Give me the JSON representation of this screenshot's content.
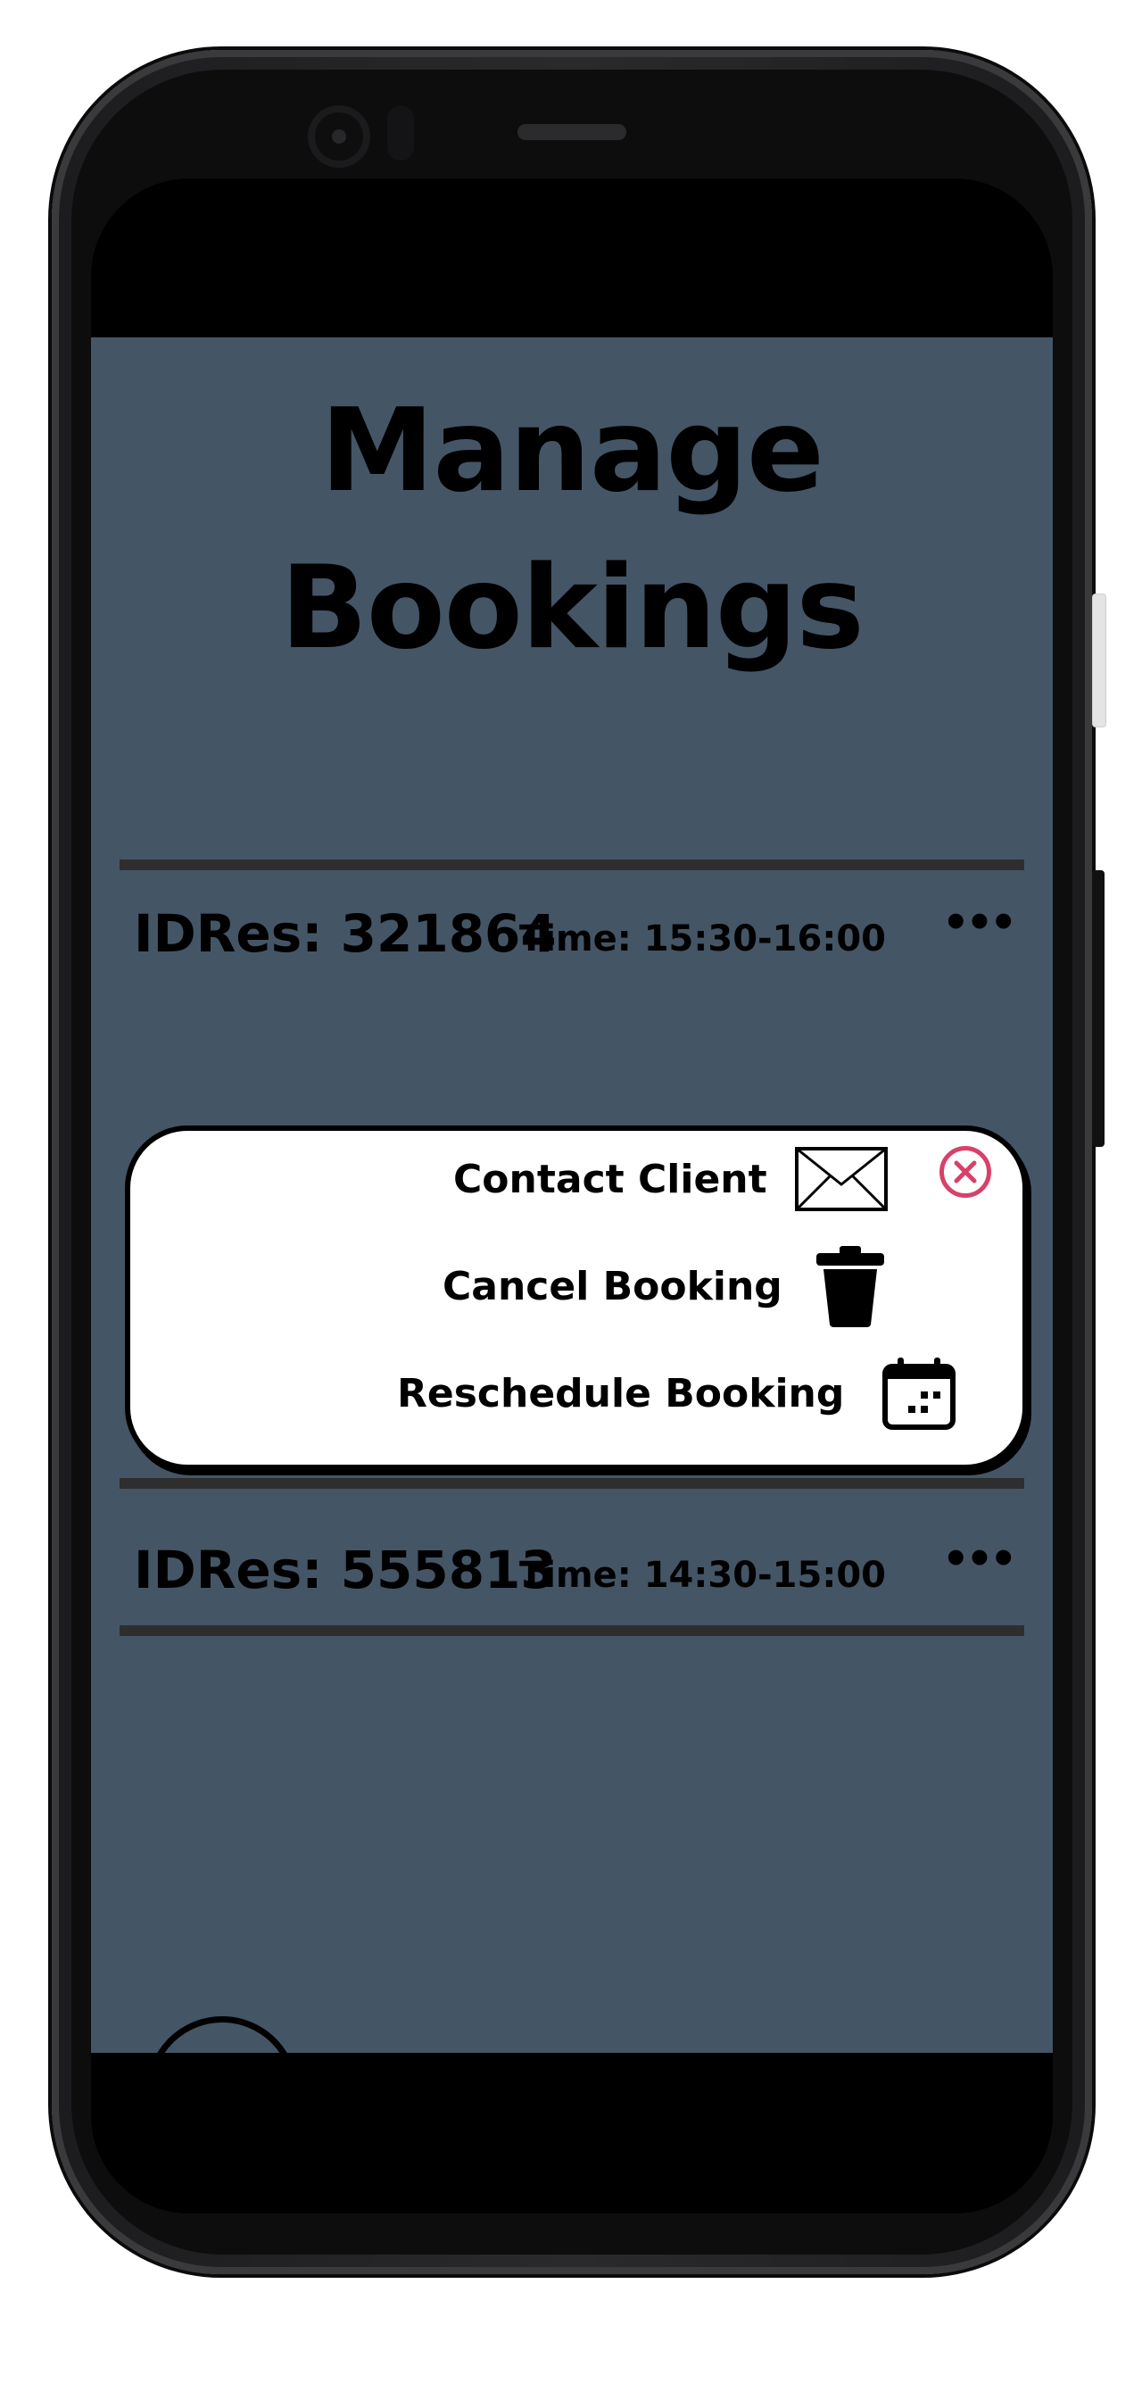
{
  "app": {
    "title_line1": "Manage",
    "title_line2": "Bookings"
  },
  "bookings": [
    {
      "id_label": "IDRes: 321864",
      "time_label": "Time: 15:30-16:00",
      "more": "•••"
    },
    {
      "id_label": "IDRes: 555813",
      "time_label": "Time: 14:30-15:00",
      "more": "•••"
    }
  ],
  "modal": {
    "contact_label": "Contact Client",
    "cancel_label": "Cancel Booking",
    "reschedule_label": "Reschedule Booking",
    "close_icon": "close-circle-icon",
    "contact_icon": "envelope-icon",
    "cancel_icon": "trash-icon",
    "reschedule_icon": "calendar-icon"
  },
  "colors": {
    "app_background": "#445566",
    "close_accent": "#d8406a"
  }
}
